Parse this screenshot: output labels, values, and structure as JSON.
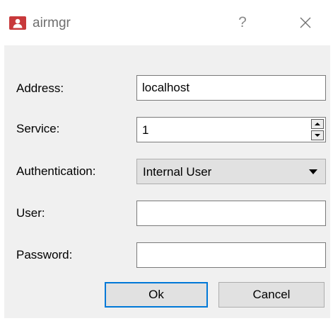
{
  "window": {
    "title": "airmgr",
    "help_symbol": "?",
    "app_icon": "user-account-icon",
    "colors": {
      "app_icon": "#c8393b",
      "client_bg": "#f0f0f0",
      "default_button_border": "#0078d7"
    }
  },
  "form": {
    "address": {
      "label": "Address:",
      "value": "localhost"
    },
    "service": {
      "label": "Service:",
      "value": "1"
    },
    "authentication": {
      "label": "Authentication:",
      "selected": "Internal User"
    },
    "user": {
      "label": "User:",
      "value": ""
    },
    "password": {
      "label": "Password:",
      "value": ""
    }
  },
  "buttons": {
    "ok": "Ok",
    "cancel": "Cancel"
  }
}
